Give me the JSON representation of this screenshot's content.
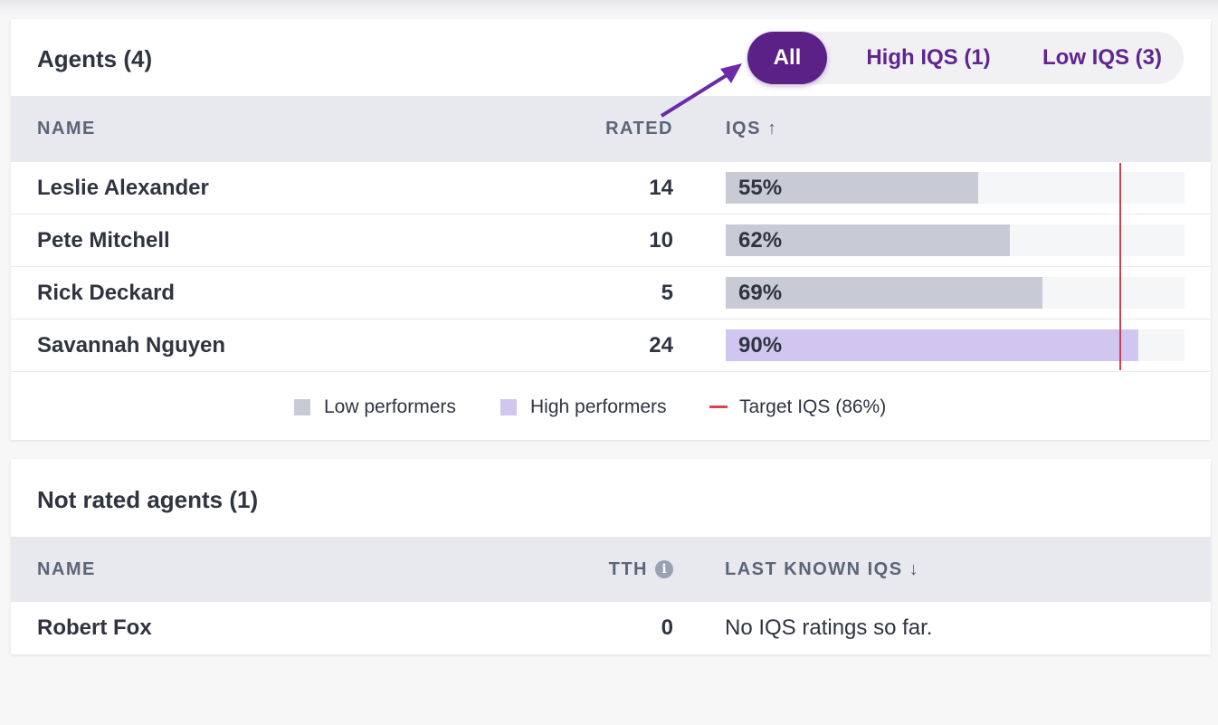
{
  "agents": {
    "title": "Agents (4)",
    "filters": [
      {
        "label": "All",
        "active": true
      },
      {
        "label": "High IQS (1)",
        "active": false
      },
      {
        "label": "Low IQS (3)",
        "active": false
      }
    ],
    "columns": {
      "name": "NAME",
      "rated": "RATED",
      "iqs": "IQS ↑"
    },
    "rows": [
      {
        "name": "Leslie Alexander",
        "rated": "14",
        "iqs_label": "55%",
        "iqs": 55,
        "group": "low"
      },
      {
        "name": "Pete Mitchell",
        "rated": "10",
        "iqs_label": "62%",
        "iqs": 62,
        "group": "low"
      },
      {
        "name": "Rick Deckard",
        "rated": "5",
        "iqs_label": "69%",
        "iqs": 69,
        "group": "low"
      },
      {
        "name": "Savannah Nguyen",
        "rated": "24",
        "iqs_label": "90%",
        "iqs": 90,
        "group": "high"
      }
    ],
    "target_iqs": 86,
    "legend": {
      "low": "Low performers",
      "high": "High performers",
      "target": "Target IQS (86%)"
    },
    "colors": {
      "low": "#c8cbd5",
      "high": "#d0c6ef",
      "target": "#c4474f",
      "accent": "#5b2187"
    }
  },
  "not_rated": {
    "title": "Not rated agents (1)",
    "columns": {
      "name": "NAME",
      "tth": "TTH",
      "tth_info_icon": "info-icon",
      "last_iqs": "LAST KNOWN IQS ↓"
    },
    "rows": [
      {
        "name": "Robert Fox",
        "tth": "0",
        "last_iqs": "No IQS ratings so far."
      }
    ]
  }
}
